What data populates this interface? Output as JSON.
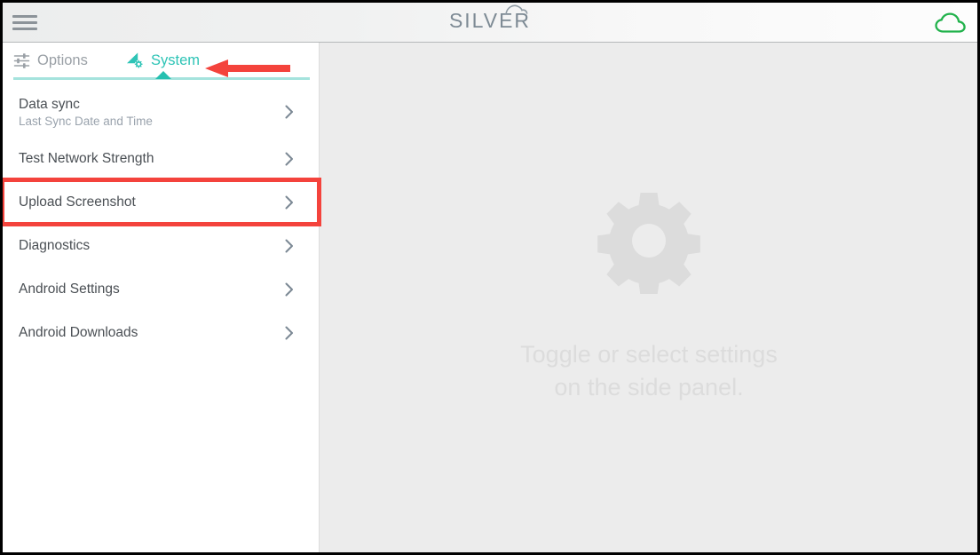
{
  "header": {
    "menu_icon": "hamburger-menu-icon",
    "brand_title": "SILVER",
    "cloud_icon": "cloud-icon",
    "cloud_color": "#22b24c"
  },
  "sidebar": {
    "tabs": [
      {
        "id": "options",
        "label": "Options",
        "icon": "tune-sliders-icon",
        "active": false
      },
      {
        "id": "system",
        "label": "System",
        "icon": "network-signal-gear-icon",
        "active": true
      }
    ],
    "active_tab": "System",
    "accent_color": "#2ec4b6",
    "underline_color": "#a5e3dd",
    "items": [
      {
        "title": "Data sync",
        "subtitle": "Last Sync Date and Time",
        "chevron": "chevron-right-icon",
        "highlighted": false
      },
      {
        "title": "Test Network Strength",
        "subtitle": "",
        "chevron": "chevron-right-icon",
        "highlighted": false
      },
      {
        "title": "Upload Screenshot",
        "subtitle": "",
        "chevron": "chevron-right-icon",
        "highlighted": true
      },
      {
        "title": "Diagnostics",
        "subtitle": "",
        "chevron": "chevron-right-icon",
        "highlighted": false
      },
      {
        "title": "Android Settings",
        "subtitle": "",
        "chevron": "chevron-right-icon",
        "highlighted": false
      },
      {
        "title": "Android Downloads",
        "subtitle": "",
        "chevron": "chevron-right-icon",
        "highlighted": false
      }
    ]
  },
  "main": {
    "empty_state_icon": "gear-icon",
    "empty_state_line1": "Toggle or select settings",
    "empty_state_line2": "on the side panel."
  },
  "annotations": {
    "arrow_color": "#f4433c",
    "highlight_box_color": "#f4433c",
    "arrow_target": "System tab",
    "highlight_target": "Upload Screenshot"
  }
}
